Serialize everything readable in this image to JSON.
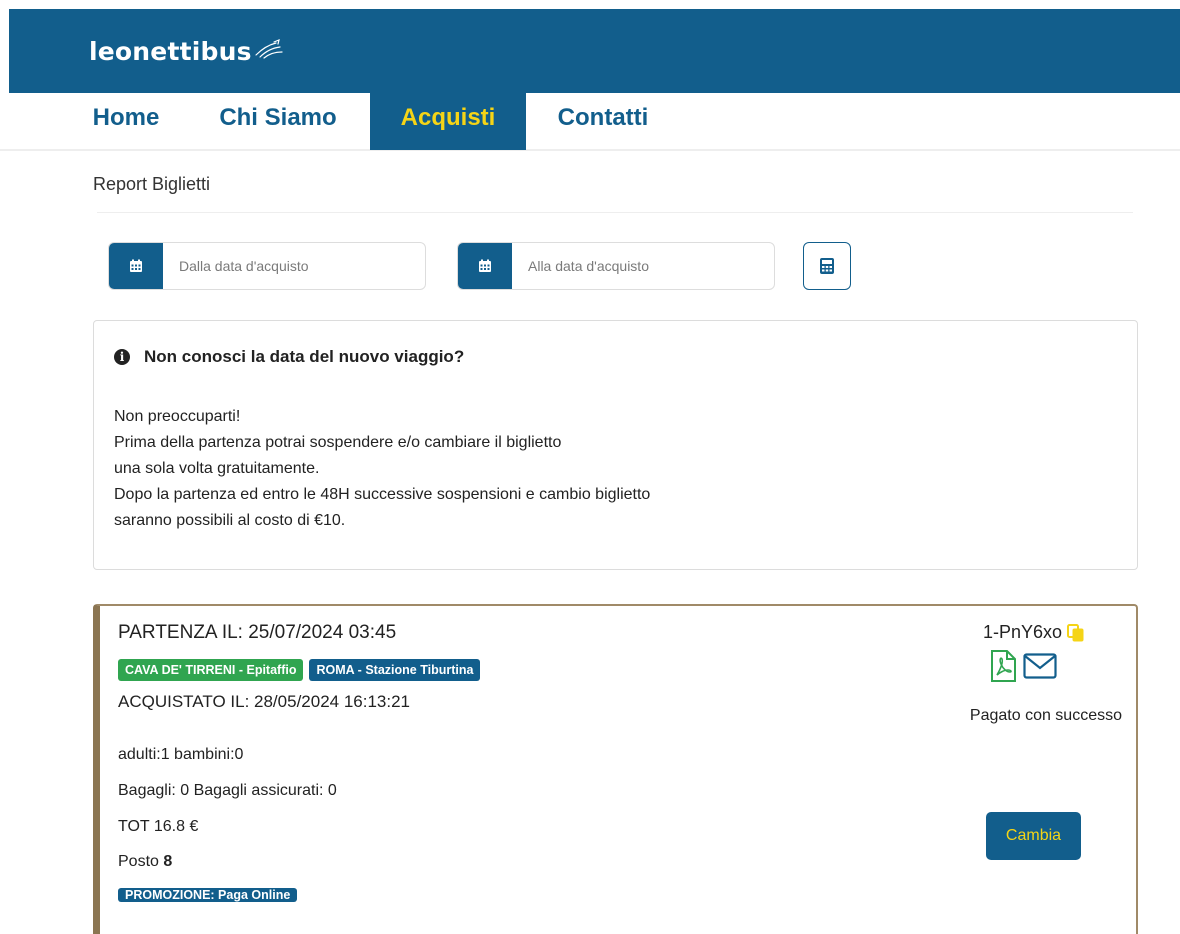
{
  "brand": {
    "logo_text": "leonettibus"
  },
  "nav": {
    "items": [
      {
        "label": "Home"
      },
      {
        "label": "Chi Siamo"
      },
      {
        "label": "Acquisti"
      },
      {
        "label": "Contatti"
      }
    ],
    "active": "Acquisti"
  },
  "page": {
    "title": "Report Biglietti"
  },
  "filters": {
    "from_placeholder": "Dalla data d'acquisto",
    "to_placeholder": "Alla data d'acquisto"
  },
  "info": {
    "heading": "Non conosci la data del nuovo viaggio?",
    "lines": [
      "Non preoccuparti!",
      "Prima della partenza potrai sospendere e/o cambiare il biglietto",
      "una sola volta gratuitamente.",
      "Dopo la partenza ed entro le 48H successive sospensioni e cambio biglietto",
      "saranno possibili al costo di €10."
    ]
  },
  "ticket": {
    "departure": "PARTENZA IL: 25/07/2024 03:45",
    "from_stop": "CAVA DE' TIRRENI - Epitaffio",
    "to_stop": "ROMA - Stazione Tiburtina",
    "purchased": "ACQUISTATO IL: 28/05/2024 16:13:21",
    "passengers": "adulti:1 bambini:0",
    "luggage": "Bagagli: 0 Bagagli assicurati: 0",
    "total": "TOT 16.8 €",
    "seat_label": "Posto",
    "seat_number": "8",
    "promo": "PROMOZIONE: Paga Online",
    "code": "1-PnY6xo",
    "status": "Pagato con successo",
    "change_label": "Cambia"
  },
  "colors": {
    "primary": "#125e8c",
    "accent_yellow": "#f5d416",
    "green": "#30a550",
    "ticket_border": "#8b7552"
  },
  "icons": [
    "calendar-icon",
    "calculator-icon",
    "info-icon",
    "copy-icon",
    "pdf-icon",
    "envelope-icon"
  ]
}
